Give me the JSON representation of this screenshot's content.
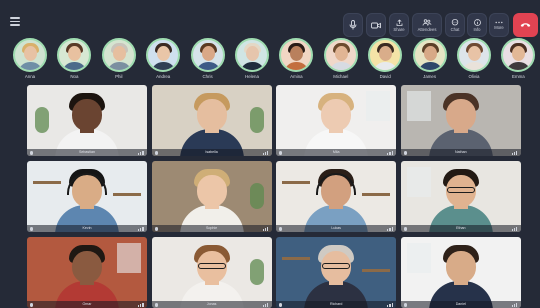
{
  "toolbar": {
    "menu_icon": "hamburger-menu-icon",
    "buttons": [
      {
        "name": "mic-button",
        "icon": "microphone-icon",
        "label": ""
      },
      {
        "name": "camera-button",
        "icon": "camera-icon",
        "label": ""
      },
      {
        "name": "share-button",
        "icon": "share-icon",
        "label": "Share"
      },
      {
        "name": "attendees-button",
        "icon": "attendees-icon",
        "label": "Attendees"
      },
      {
        "name": "chat-button",
        "icon": "chat-icon",
        "label": "Chat"
      },
      {
        "name": "info-button",
        "icon": "info-icon",
        "label": "Info"
      },
      {
        "name": "more-button",
        "icon": "more-icon",
        "label": "More"
      },
      {
        "name": "end-call-button",
        "icon": "phone-hangup-icon",
        "label": ""
      }
    ],
    "end_call_color": "#e14352"
  },
  "participants": [
    {
      "name": "Anna",
      "skin": "#e7c2a4",
      "hair": "#d9b06a",
      "shirt": "#6f8ea6",
      "bg": "#cfe3d1"
    },
    {
      "name": "Noa",
      "skin": "#e8c1a0",
      "hair": "#5a3a26",
      "shirt": "#4d6b8a",
      "bg": "#d7e8d3"
    },
    {
      "name": "Phil",
      "skin": "#e6bf9f",
      "hair": "#c9c4bb",
      "shirt": "#7b8fa0",
      "bg": "#d5e4d0"
    },
    {
      "name": "Andrea",
      "skin": "#e9c6a8",
      "hair": "#3b2a22",
      "shirt": "#2f3f55",
      "bg": "#cfe0ee"
    },
    {
      "name": "Chris",
      "skin": "#d9a887",
      "hair": "#5a3a22",
      "shirt": "#3d5a86",
      "bg": "#d5e3ea"
    },
    {
      "name": "Helena",
      "skin": "#e6c5ac",
      "hair": "#e3d8c6",
      "shirt": "#1f2d3d",
      "bg": "#d0e5e4"
    },
    {
      "name": "Amina",
      "skin": "#b9805d",
      "hair": "#2a1c17",
      "shirt": "#c36e3f",
      "bg": "#f1d6c4"
    },
    {
      "name": "Michael",
      "skin": "#e1b594",
      "hair": "#6b4a2d",
      "shirt": "#d7dbe2",
      "bg": "#f0d8c9"
    },
    {
      "name": "David",
      "skin": "#d9ad8a",
      "hair": "#3b2b21",
      "shirt": "#e7e9ec",
      "bg": "#f4e3a7"
    },
    {
      "name": "James",
      "skin": "#d7a987",
      "hair": "#5b4028",
      "shirt": "#2e466a",
      "bg": "#e6e4c4"
    },
    {
      "name": "Olivia",
      "skin": "#e8c3a6",
      "hair": "#6e4a33",
      "shirt": "#e9e2da",
      "bg": "#dde4ea"
    },
    {
      "name": "Emma",
      "skin": "#e2b896",
      "hair": "#4a2f22",
      "shirt": "#3e3a3d",
      "bg": "#e9dfe3"
    }
  ],
  "tiles": [
    {
      "name": "Sebastian",
      "bg": "#e9e8e6",
      "skin": "#6a4431",
      "hair": "#1c140f",
      "shirt": "#f3f3f3",
      "glasses": false,
      "headset": false,
      "accent": "plant"
    },
    {
      "name": "Isabella",
      "bg": "#d8d1c4",
      "skin": "#e5be9f",
      "hair": "#c69a5e",
      "shirt": "#2a3a56",
      "glasses": false,
      "headset": false,
      "accent": "plant"
    },
    {
      "name": "Mila",
      "bg": "#f0efee",
      "skin": "#edcbb2",
      "hair": "#d7b27e",
      "shirt": "#f7f7f7",
      "glasses": false,
      "headset": false,
      "accent": "window"
    },
    {
      "name": "Nathan",
      "bg": "#b9b6b1",
      "skin": "#d8a98a",
      "hair": "#4b3326",
      "shirt": "#5b6270",
      "glasses": false,
      "headset": false,
      "accent": "window"
    },
    {
      "name": "Kevin",
      "bg": "#e7ebee",
      "skin": "#d9ac86",
      "hair": "#151515",
      "shirt": "#5d86b0",
      "glasses": false,
      "headset": true,
      "accent": "shelf"
    },
    {
      "name": "Sophie",
      "bg": "#9d8a73",
      "skin": "#ecc6a8",
      "hair": "#cfae77",
      "shirt": "#f1efea",
      "glasses": false,
      "headset": false,
      "accent": "plant"
    },
    {
      "name": "Lukas",
      "bg": "#ece9e4",
      "skin": "#d2a07f",
      "hair": "#2b1f18",
      "shirt": "#7aa0c2",
      "glasses": false,
      "headset": true,
      "accent": "shelf"
    },
    {
      "name": "Ethan",
      "bg": "#e8e6e1",
      "skin": "#e0b390",
      "hair": "#231a14",
      "shirt": "#5b8f8d",
      "glasses": true,
      "headset": false,
      "accent": "window"
    },
    {
      "name": "Omar",
      "bg": "#b3593f",
      "skin": "#8a5a40",
      "hair": "#1f1813",
      "shirt": "#b33a34",
      "glasses": false,
      "headset": false,
      "accent": "window"
    },
    {
      "name": "Jonas",
      "bg": "#ebe8e4",
      "skin": "#e9bf9f",
      "hair": "#8a5a34",
      "shirt": "#f3f1ee",
      "glasses": true,
      "headset": false,
      "accent": "plant"
    },
    {
      "name": "Richard",
      "bg": "#3f5f80",
      "skin": "#e6bd9f",
      "hair": "#cfcac3",
      "shirt": "#2c3142",
      "glasses": true,
      "headset": false,
      "accent": "shelf"
    },
    {
      "name": "Daniel",
      "bg": "#f2f2f2",
      "skin": "#d8ab88",
      "hair": "#2e2119",
      "shirt": "#26324a",
      "glasses": false,
      "headset": false,
      "accent": "window"
    }
  ]
}
